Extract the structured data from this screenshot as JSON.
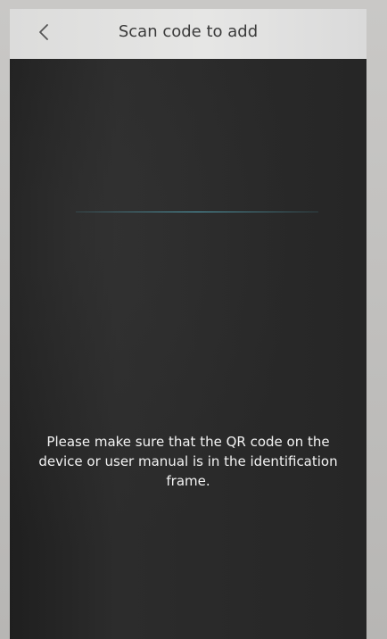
{
  "header": {
    "title": "Scan code to add",
    "back_icon": "chevron-left-icon"
  },
  "scanner": {
    "hint": "Please make sure that the QR code on the device or user manual is in the identification frame."
  },
  "colors": {
    "header_bg": "#e3e3e2",
    "camera_bg": "#272727",
    "scan_line": "#5ab8cc",
    "hint_text": "#f3f3f3"
  }
}
